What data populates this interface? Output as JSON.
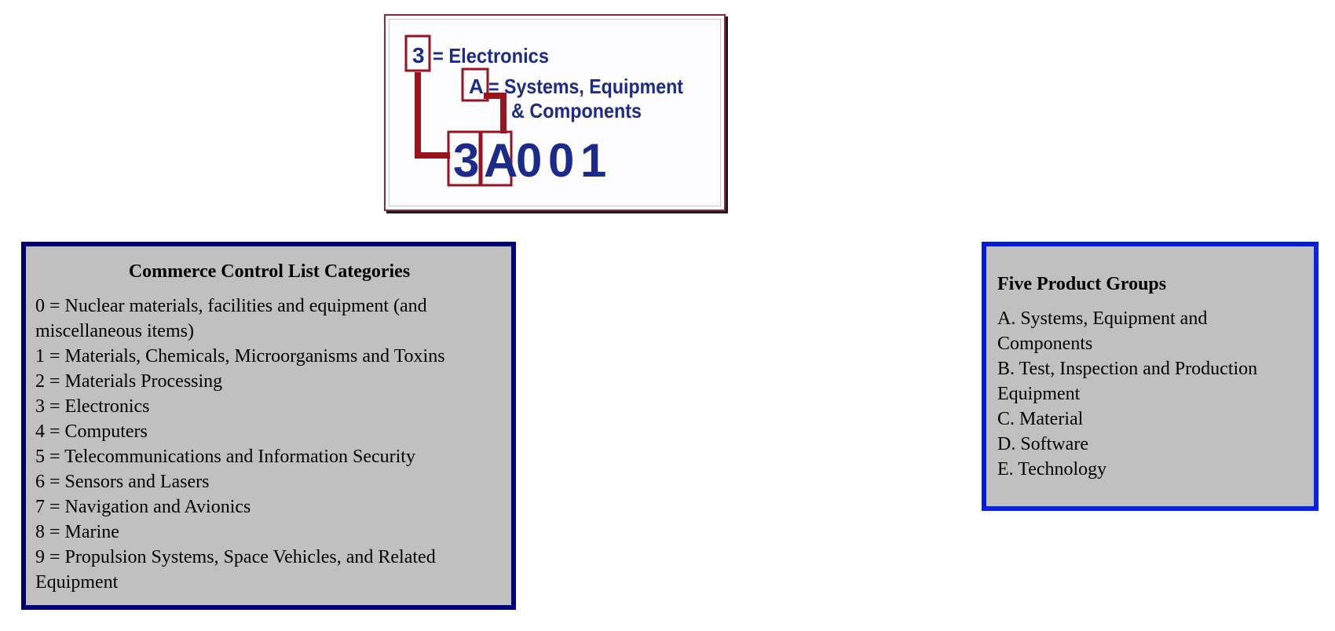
{
  "logo": {
    "line1_code": "3",
    "line1_text": "= Electronics",
    "line2_code": "A",
    "line2_text": "= Systems, Equipment",
    "line3_text": "& Components",
    "code_digits": [
      "3",
      "A",
      "0",
      "0",
      "1"
    ],
    "colors": {
      "text": "#1c2a8c",
      "connector": "#9a1420"
    }
  },
  "ccl_categories": {
    "title": "Commerce Control List Categories",
    "items": [
      "0 = Nuclear materials, facilities and equipment (and miscellaneous items)",
      "1 = Materials, Chemicals, Microorganisms and Toxins",
      "2 = Materials Processing",
      "3 = Electronics",
      "4 = Computers",
      "5 = Telecommunications and Information Security",
      "6 = Sensors and Lasers",
      "7 = Navigation and Avionics",
      "8 = Marine",
      "9 = Propulsion Systems, Space Vehicles, and Related Equipment"
    ],
    "border_color": "#000080",
    "background": "#c0c0c0"
  },
  "product_groups": {
    "title": "Five Product Groups",
    "items": [
      "A. Systems, Equipment and Components",
      "B. Test, Inspection and Production Equipment",
      "C. Material",
      "D. Software",
      "E. Technology"
    ],
    "border_color": "#0a22ee",
    "background": "#c0c0c0"
  }
}
